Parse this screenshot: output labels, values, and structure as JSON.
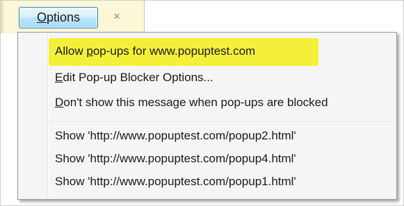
{
  "notification_bar": {
    "options_button": {
      "label_accel": "O",
      "label_rest": "ptions"
    },
    "close_glyph": "×"
  },
  "menu": {
    "items": [
      {
        "pre": "Allow ",
        "accel": "p",
        "post": "op-ups for www.popuptest.com"
      },
      {
        "pre": "",
        "accel": "E",
        "post": "dit Pop-up Blocker Options..."
      },
      {
        "pre": "",
        "accel": "D",
        "post": "on't show this message when pop-ups are blocked"
      },
      {
        "pre": "Show 'http://www.popuptest.com/popup2.html'",
        "accel": "",
        "post": ""
      },
      {
        "pre": "Show 'http://www.popuptest.com/popup4.html'",
        "accel": "",
        "post": ""
      },
      {
        "pre": "Show 'http://www.popuptest.com/popup1.html'",
        "accel": "",
        "post": ""
      }
    ]
  },
  "colors": {
    "highlight": "#f4f03a",
    "notification_bar": "#fbf7d7",
    "button_border": "#3c7fb1"
  }
}
